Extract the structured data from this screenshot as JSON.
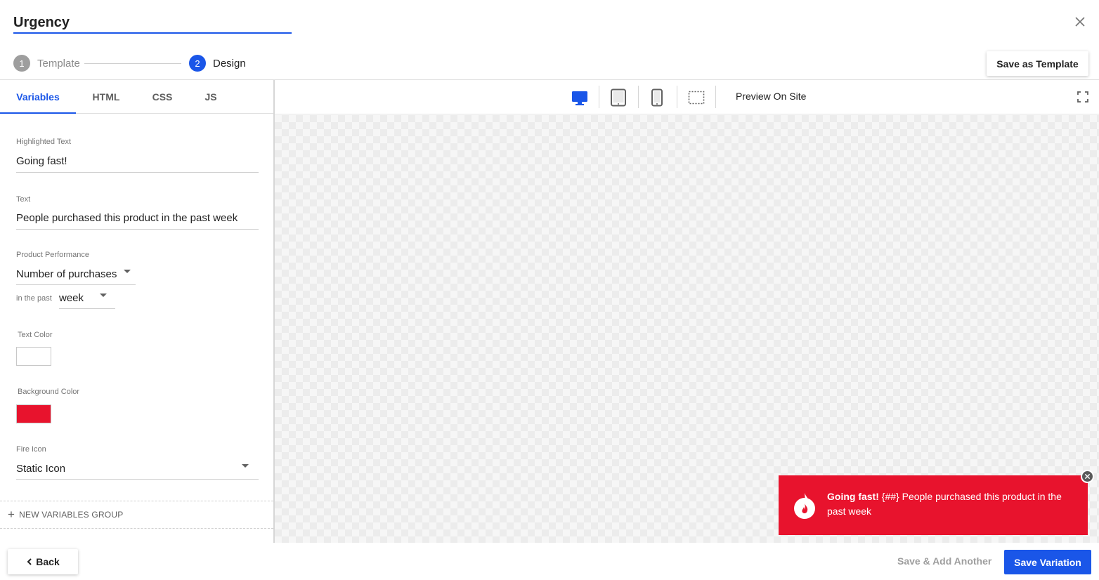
{
  "header": {
    "title_value": "Urgency",
    "close_icon": "close-icon",
    "steps": [
      {
        "number": "1",
        "label": "Template"
      },
      {
        "number": "2",
        "label": "Design"
      }
    ],
    "save_template_label": "Save as Template"
  },
  "editor": {
    "tabs": [
      {
        "label": "Variables"
      },
      {
        "label": "HTML"
      },
      {
        "label": "CSS"
      },
      {
        "label": "JS"
      }
    ],
    "fields": {
      "highlighted_text": {
        "label": "Highlighted Text",
        "value": "Going fast!"
      },
      "text": {
        "label": "Text",
        "value": "People purchased this product in the past week"
      },
      "product_performance": {
        "label": "Product Performance",
        "value": "Number of purchases"
      },
      "in_the_past": {
        "label": "in the past",
        "value": "week"
      },
      "text_color": {
        "label": "Text Color",
        "value": "#ffffff"
      },
      "background_color": {
        "label": "Background Color",
        "value": "#e8132d"
      },
      "fire_icon": {
        "label": "Fire Icon",
        "value": "Static Icon"
      }
    },
    "new_group_label": "NEW VARIABLES GROUP"
  },
  "preview": {
    "devices": [
      "desktop-icon",
      "tablet-icon",
      "mobile-icon",
      "custom-size-icon"
    ],
    "active_device": "desktop-icon",
    "preview_on_site_label": "Preview On Site",
    "toast": {
      "highlight": "Going fast!",
      "placeholder": "{##}",
      "message": "People purchased this product in the past week"
    }
  },
  "footer": {
    "back_label": "Back",
    "save_add_another_label": "Save & Add Another",
    "save_variation_label": "Save Variation"
  },
  "colors": {
    "accent": "#1a56e8",
    "toast_bg": "#e8132d"
  }
}
